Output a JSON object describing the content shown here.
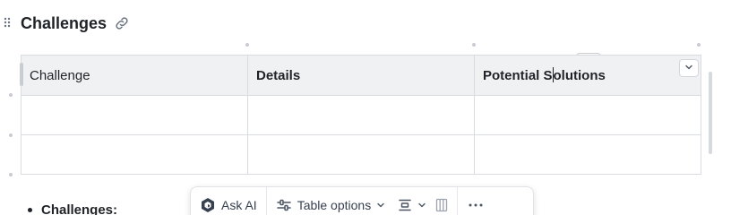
{
  "section": {
    "heading": "Challenges",
    "heading_icon": "link-icon"
  },
  "table": {
    "headers": [
      "Challenge",
      "Details",
      "Potential Solutions"
    ],
    "caret_after": "Potential S",
    "caret_before": "olutions",
    "rows": [
      [
        "",
        "",
        ""
      ],
      [
        "",
        "",
        ""
      ]
    ]
  },
  "list": {
    "first_item": "Challenges:"
  },
  "toolbar": {
    "ask_ai_label": "Ask AI",
    "table_options_label": "Table options",
    "icons": [
      "ai-logo-icon",
      "sliders-icon",
      "chevron-down-icon",
      "align-icon",
      "chevron-down-icon",
      "columns-icon",
      "more-icon"
    ]
  },
  "colors": {
    "header_bg": "#f0f1f3",
    "border": "#d8dbdf",
    "text": "#1f2328"
  }
}
